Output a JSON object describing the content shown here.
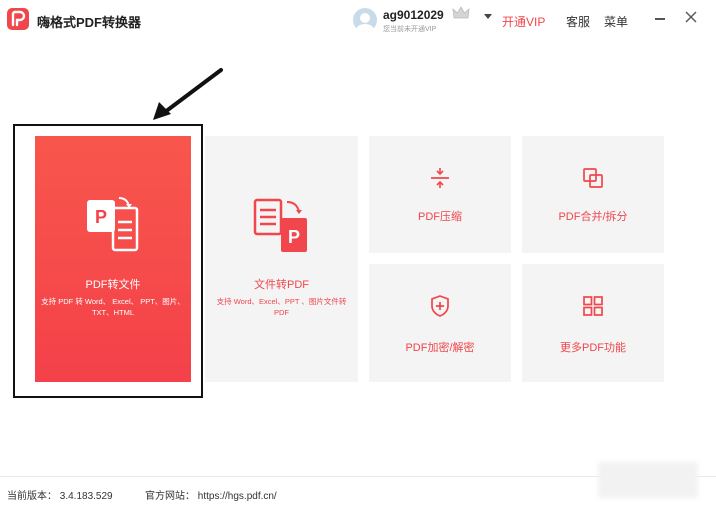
{
  "app": {
    "title": "嗨格式PDF转换器"
  },
  "account": {
    "username": "ag9012029",
    "vip_note": "您当前未开通VIP"
  },
  "header": {
    "open_vip": "开通VIP",
    "service": "客服",
    "menu": "菜单"
  },
  "features": {
    "pdf_to_file": {
      "title": "PDF转文件",
      "desc": "支持 PDF 转 Word、 Excel、 PPT、图片、TXT、HTML"
    },
    "file_to_pdf": {
      "title": "文件转PDF",
      "desc": "支持 Word、Excel、PPT 、图片文件转 PDF"
    },
    "compress": {
      "title": "PDF压缩"
    },
    "merge_split": {
      "title": "PDF合并/拆分"
    },
    "encrypt": {
      "title": "PDF加密/解密"
    },
    "more": {
      "title": "更多PDF功能"
    }
  },
  "status": {
    "version": "当前版本： 3.4.183.529",
    "website": "官方网站： https://hgs.pdf.cn/"
  },
  "colors": {
    "accent": "#f0464c",
    "card_bg": "#f4f4f4"
  }
}
